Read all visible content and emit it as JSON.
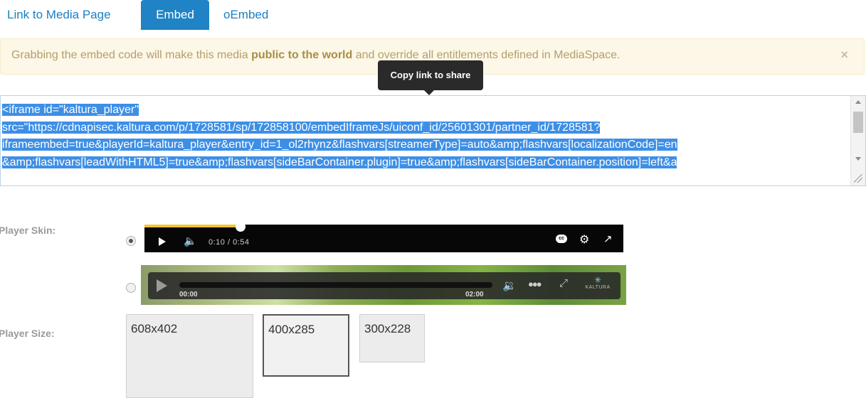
{
  "tabs": {
    "link": "Link to Media Page",
    "embed": "Embed",
    "oembed": "oEmbed",
    "active": "Embed"
  },
  "alert": {
    "text_before": "Grabbing the embed code will make this media ",
    "text_bold": "public to the world",
    "text_after": " and override all entitlements defined in MediaSpace.",
    "close_label": "×"
  },
  "tooltip": {
    "text": "Copy link to share"
  },
  "embed_code": {
    "lines": [
      "<iframe id=\"kaltura_player\"",
      "src=\"https://cdnapisec.kaltura.com/p/1728581/sp/172858100/embedIframeJs/uiconf_id/25601301/partner_id/1728581?",
      "iframeembed=true&playerId=kaltura_player&entry_id=1_ol2rhynz&flashvars[streamerType]=auto&amp;flashvars[localizationCode]=en",
      "&amp;flashvars[leadWithHTML5]=true&amp;flashvars[sideBarContainer.plugin]=true&amp;flashvars[sideBarContainer.position]=left&a"
    ]
  },
  "player_skin": {
    "label": "Player Skin:",
    "selected": "skin1",
    "skin1": {
      "time": "0:10 / 0:54",
      "progress": 0.2,
      "cc_label": "cc"
    },
    "skin2": {
      "time_start": "00:00",
      "time_end": "02:00",
      "logo_text": "KALTURA"
    }
  },
  "player_size": {
    "label": "Player Size:",
    "options": [
      "608x402",
      "400x285",
      "300x228"
    ],
    "selected": "400x285"
  },
  "colors": {
    "accent": "#1f83c5",
    "selection": "#3d8fe6",
    "alert_bg": "#fcf7e6",
    "progress": "#f3c531"
  },
  "icons": {
    "close": "close-icon",
    "play": "play-icon",
    "volume": "volume-icon",
    "cc": "closed-captions-icon",
    "settings": "gear-icon",
    "fullscreen": "fullscreen-icon",
    "people": "people-icon",
    "logo": "kaltura-logo-icon"
  }
}
